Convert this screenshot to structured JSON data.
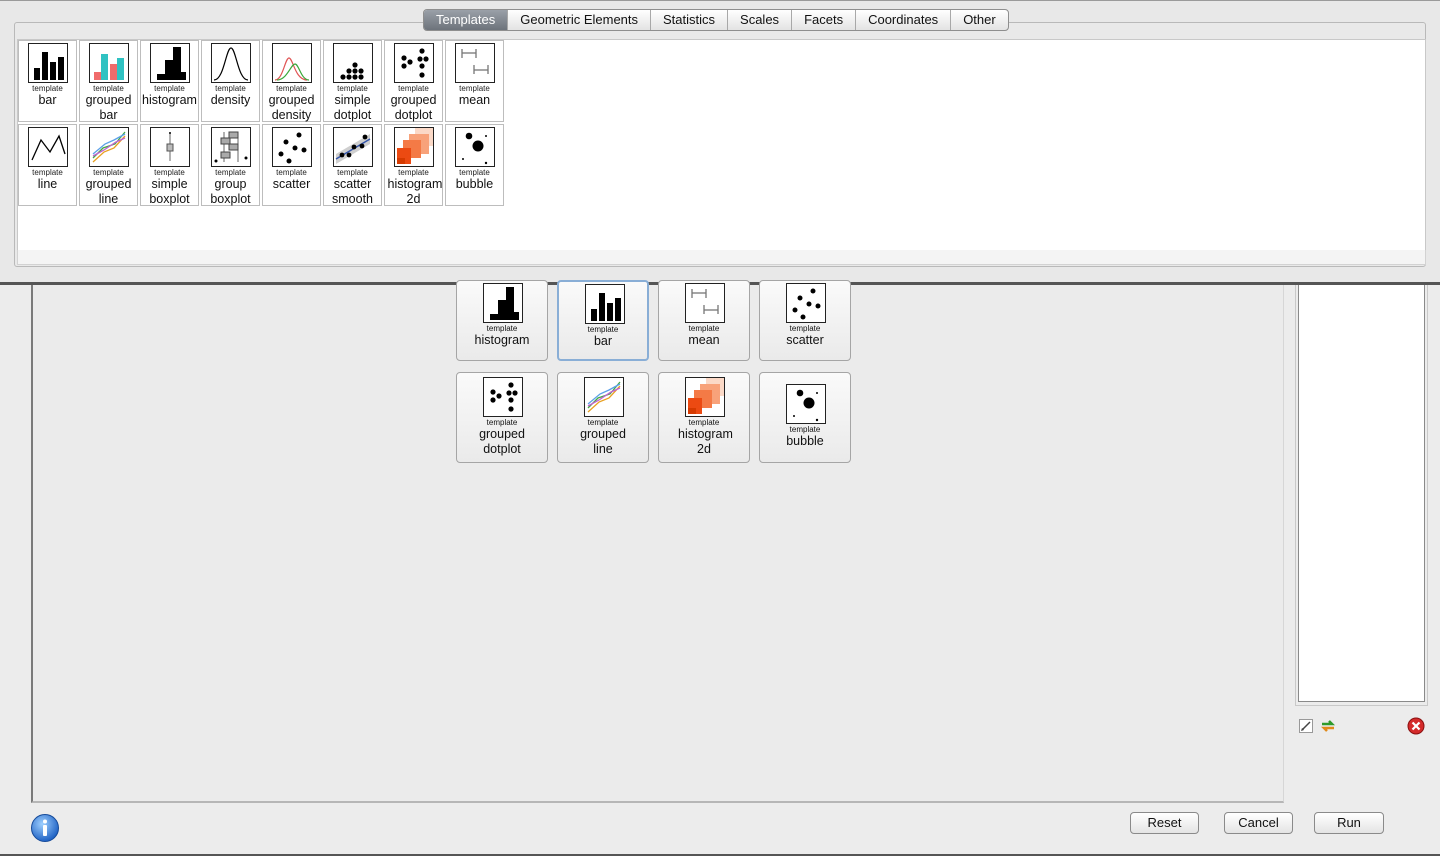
{
  "tabs": [
    {
      "label": "Templates",
      "active": true
    },
    {
      "label": "Geometric Elements"
    },
    {
      "label": "Statistics"
    },
    {
      "label": "Scales"
    },
    {
      "label": "Facets"
    },
    {
      "label": "Coordinates"
    },
    {
      "label": "Other"
    }
  ],
  "gallery": [
    {
      "small": "template",
      "label": "bar",
      "icon": "bar-chart-icon"
    },
    {
      "small": "template",
      "label": "grouped bar",
      "icon": "grouped-bar-chart-icon"
    },
    {
      "small": "template",
      "label": "histogram",
      "icon": "histogram-icon"
    },
    {
      "small": "template",
      "label": "density",
      "icon": "density-curve-icon"
    },
    {
      "small": "template",
      "label": "grouped density",
      "icon": "grouped-density-icon"
    },
    {
      "small": "template",
      "label": "simple dotplot",
      "icon": "dotplot-icon"
    },
    {
      "small": "template",
      "label": "grouped dotplot",
      "icon": "grouped-dotplot-icon"
    },
    {
      "small": "template",
      "label": "mean",
      "icon": "mean-errorbar-icon"
    },
    {
      "small": "template",
      "label": "line",
      "icon": "line-chart-icon"
    },
    {
      "small": "template",
      "label": "grouped line",
      "icon": "grouped-line-icon"
    },
    {
      "small": "template",
      "label": "simple boxplot",
      "icon": "boxplot-icon"
    },
    {
      "small": "template",
      "label": "group boxplot",
      "icon": "grouped-boxplot-icon"
    },
    {
      "small": "template",
      "label": "scatter",
      "icon": "scatter-icon"
    },
    {
      "small": "template",
      "label": "scatter smooth",
      "icon": "scatter-smooth-icon"
    },
    {
      "small": "template",
      "label": "histogram 2d",
      "icon": "histogram-2d-icon"
    },
    {
      "small": "template",
      "label": "bubble",
      "icon": "bubble-icon"
    }
  ],
  "layers": [
    {
      "small": "template",
      "label": "histogram",
      "icon": "histogram-icon"
    },
    {
      "small": "template",
      "label": "bar",
      "icon": "bar-chart-icon",
      "selected": true
    },
    {
      "small": "template",
      "label": "mean",
      "icon": "mean-errorbar-icon"
    },
    {
      "small": "template",
      "label": "scatter",
      "icon": "scatter-icon"
    },
    {
      "small": "template",
      "label": "grouped dotplot",
      "icon": "grouped-dotplot-icon"
    },
    {
      "small": "template",
      "label": "grouped line",
      "icon": "grouped-line-icon"
    },
    {
      "small": "template",
      "label": "histogram 2d",
      "icon": "histogram-2d-icon"
    },
    {
      "small": "template",
      "label": "bubble",
      "icon": "bubble-icon"
    }
  ],
  "buttons": {
    "reset": "Reset",
    "cancel": "Cancel",
    "run": "Run"
  },
  "icons": {
    "info": "info-icon",
    "edit": "edit-icon",
    "refresh": "refresh-icon",
    "delete": "delete-icon"
  }
}
